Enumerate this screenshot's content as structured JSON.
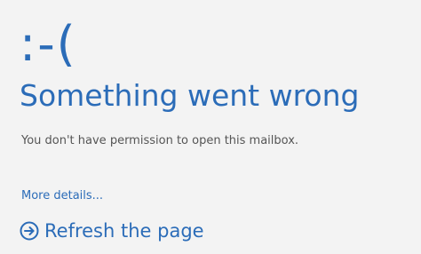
{
  "error": {
    "emoticon": ":-(",
    "title": "Something went wrong",
    "message": "You don't have permission to open this mailbox.",
    "more_details_link": "More details...",
    "refresh_label": "Refresh the page",
    "refresh_icon": "circle-arrow-right-icon"
  },
  "colors": {
    "accent": "#2b6cb8",
    "background": "#f3f3f3",
    "body_text": "#555555"
  }
}
